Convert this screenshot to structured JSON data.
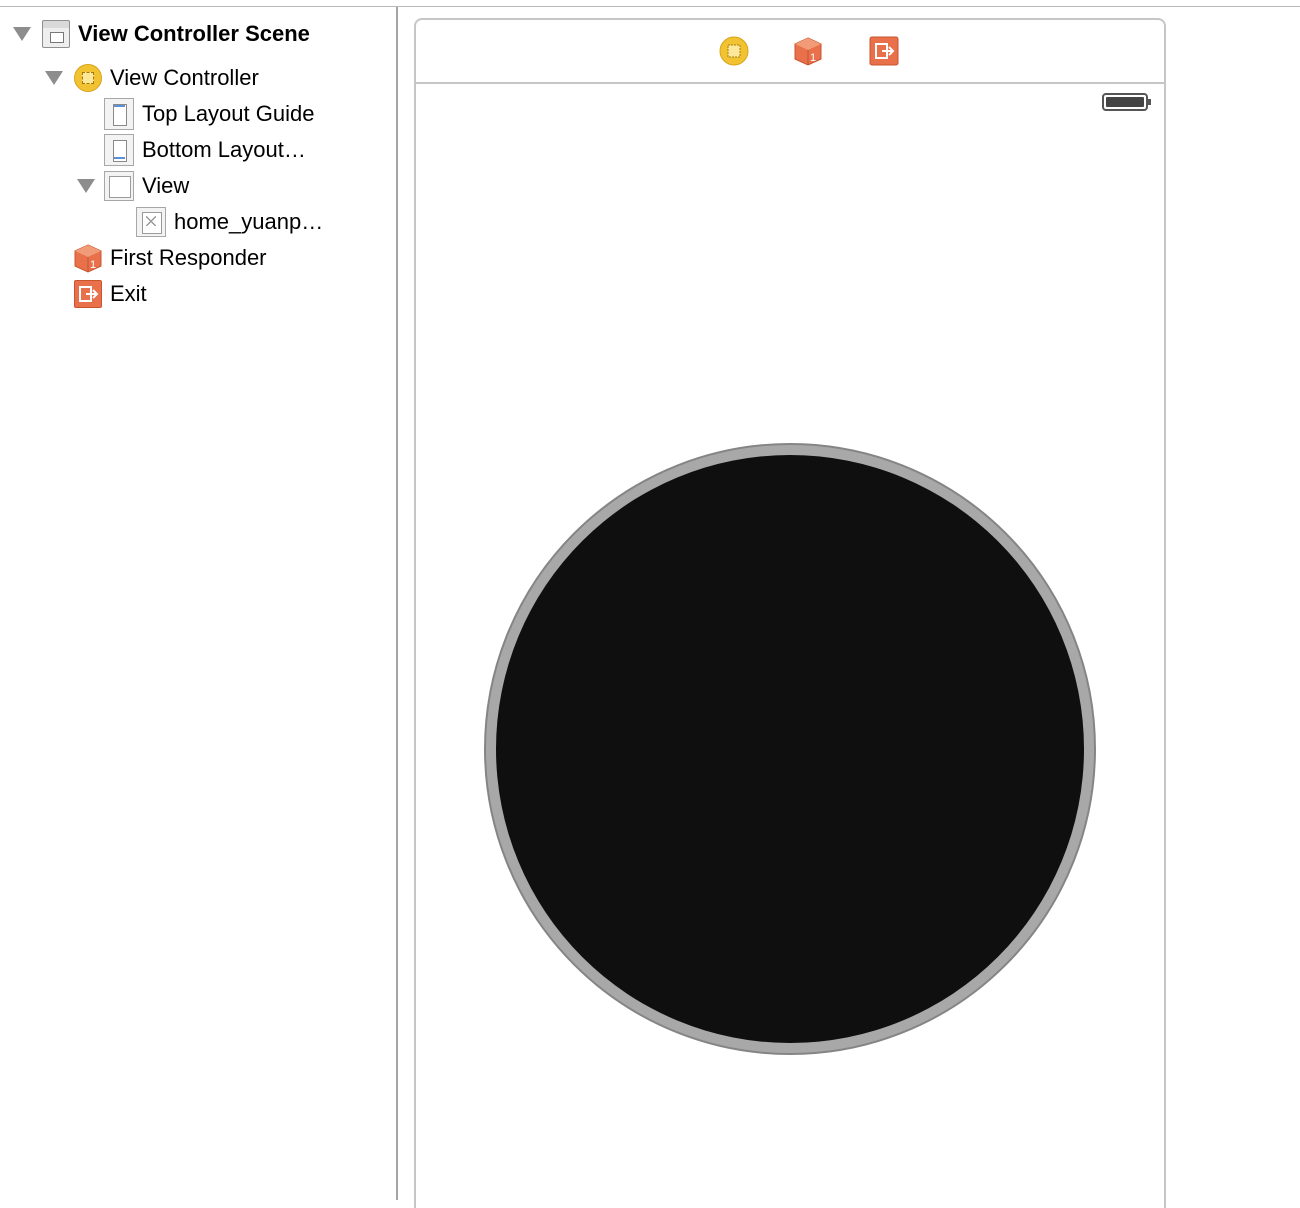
{
  "outline": {
    "items": [
      {
        "label": "View Controller Scene",
        "icon": "scene-icon",
        "expanded": true
      },
      {
        "label": "View Controller",
        "icon": "view-controller-icon",
        "expanded": true
      },
      {
        "label": "Top Layout Guide",
        "icon": "layout-guide-icon"
      },
      {
        "label": "Bottom Layout…",
        "icon": "layout-guide-icon"
      },
      {
        "label": "View",
        "icon": "view-icon",
        "expanded": true
      },
      {
        "label": "home_yuanp…",
        "icon": "image-view-icon"
      },
      {
        "label": "First Responder",
        "icon": "first-responder-icon"
      },
      {
        "label": "Exit",
        "icon": "exit-icon"
      }
    ]
  },
  "canvas": {
    "scene_dock": [
      "view-controller-icon",
      "first-responder-icon",
      "exit-icon"
    ],
    "status_bar": {
      "battery": "battery-icon"
    },
    "image_view": {
      "shape": "circle",
      "fill": "#0f0f0f",
      "ring": "#a8a8a8"
    }
  },
  "colors": {
    "view_controller": "#f1c232",
    "first_responder": "#e8704a",
    "exit": "#e8704a",
    "disclosure": "#8d8d8d",
    "frame_border": "#c6c6c6"
  }
}
